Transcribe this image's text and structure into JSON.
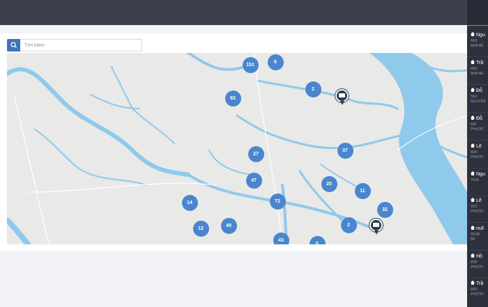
{
  "search": {
    "placeholder": "Tìm kiếm",
    "icon": "search-icon"
  },
  "map": {
    "clusters": [
      "151",
      "6",
      "2",
      "83",
      "37",
      "27",
      "47",
      "20",
      "11",
      "72",
      "14",
      "49",
      "12",
      "32",
      "2",
      "43",
      "5"
    ],
    "pins": [
      "house-marker-icon",
      "house-marker-icon"
    ],
    "colors": {
      "water": "#8fc9ec",
      "land": "#e9e9e7",
      "cluster": "#4a86cf",
      "pin": "#2a3b52"
    }
  },
  "sidebar": {
    "items": [
      {
        "name": "Ngu",
        "addr": "692/",
        "dist": "NHÀ BÈ"
      },
      {
        "name": "Trầ",
        "addr": "692/",
        "dist": "NHÀ BÈ"
      },
      {
        "name": "Đỗ",
        "addr": "501/",
        "dist": "NGUYỄN"
      },
      {
        "name": "Đỗ",
        "addr": "696",
        "dist": "PHƯỚC"
      },
      {
        "name": "Lê",
        "addr": "804/",
        "dist": "PHƯỚC"
      },
      {
        "name": "Ngu",
        "addr": "702A",
        "dist": ""
      },
      {
        "name": "Lê",
        "addr": "337/",
        "dist": "PHƯỚC"
      },
      {
        "name": "null",
        "addr": "55/3B",
        "dist": "BÈ"
      },
      {
        "name": "Hồ",
        "addr": "835/",
        "dist": "PHƯỚC"
      },
      {
        "name": "Trầ",
        "addr": "845/",
        "dist": "PHƯỚC"
      }
    ]
  }
}
